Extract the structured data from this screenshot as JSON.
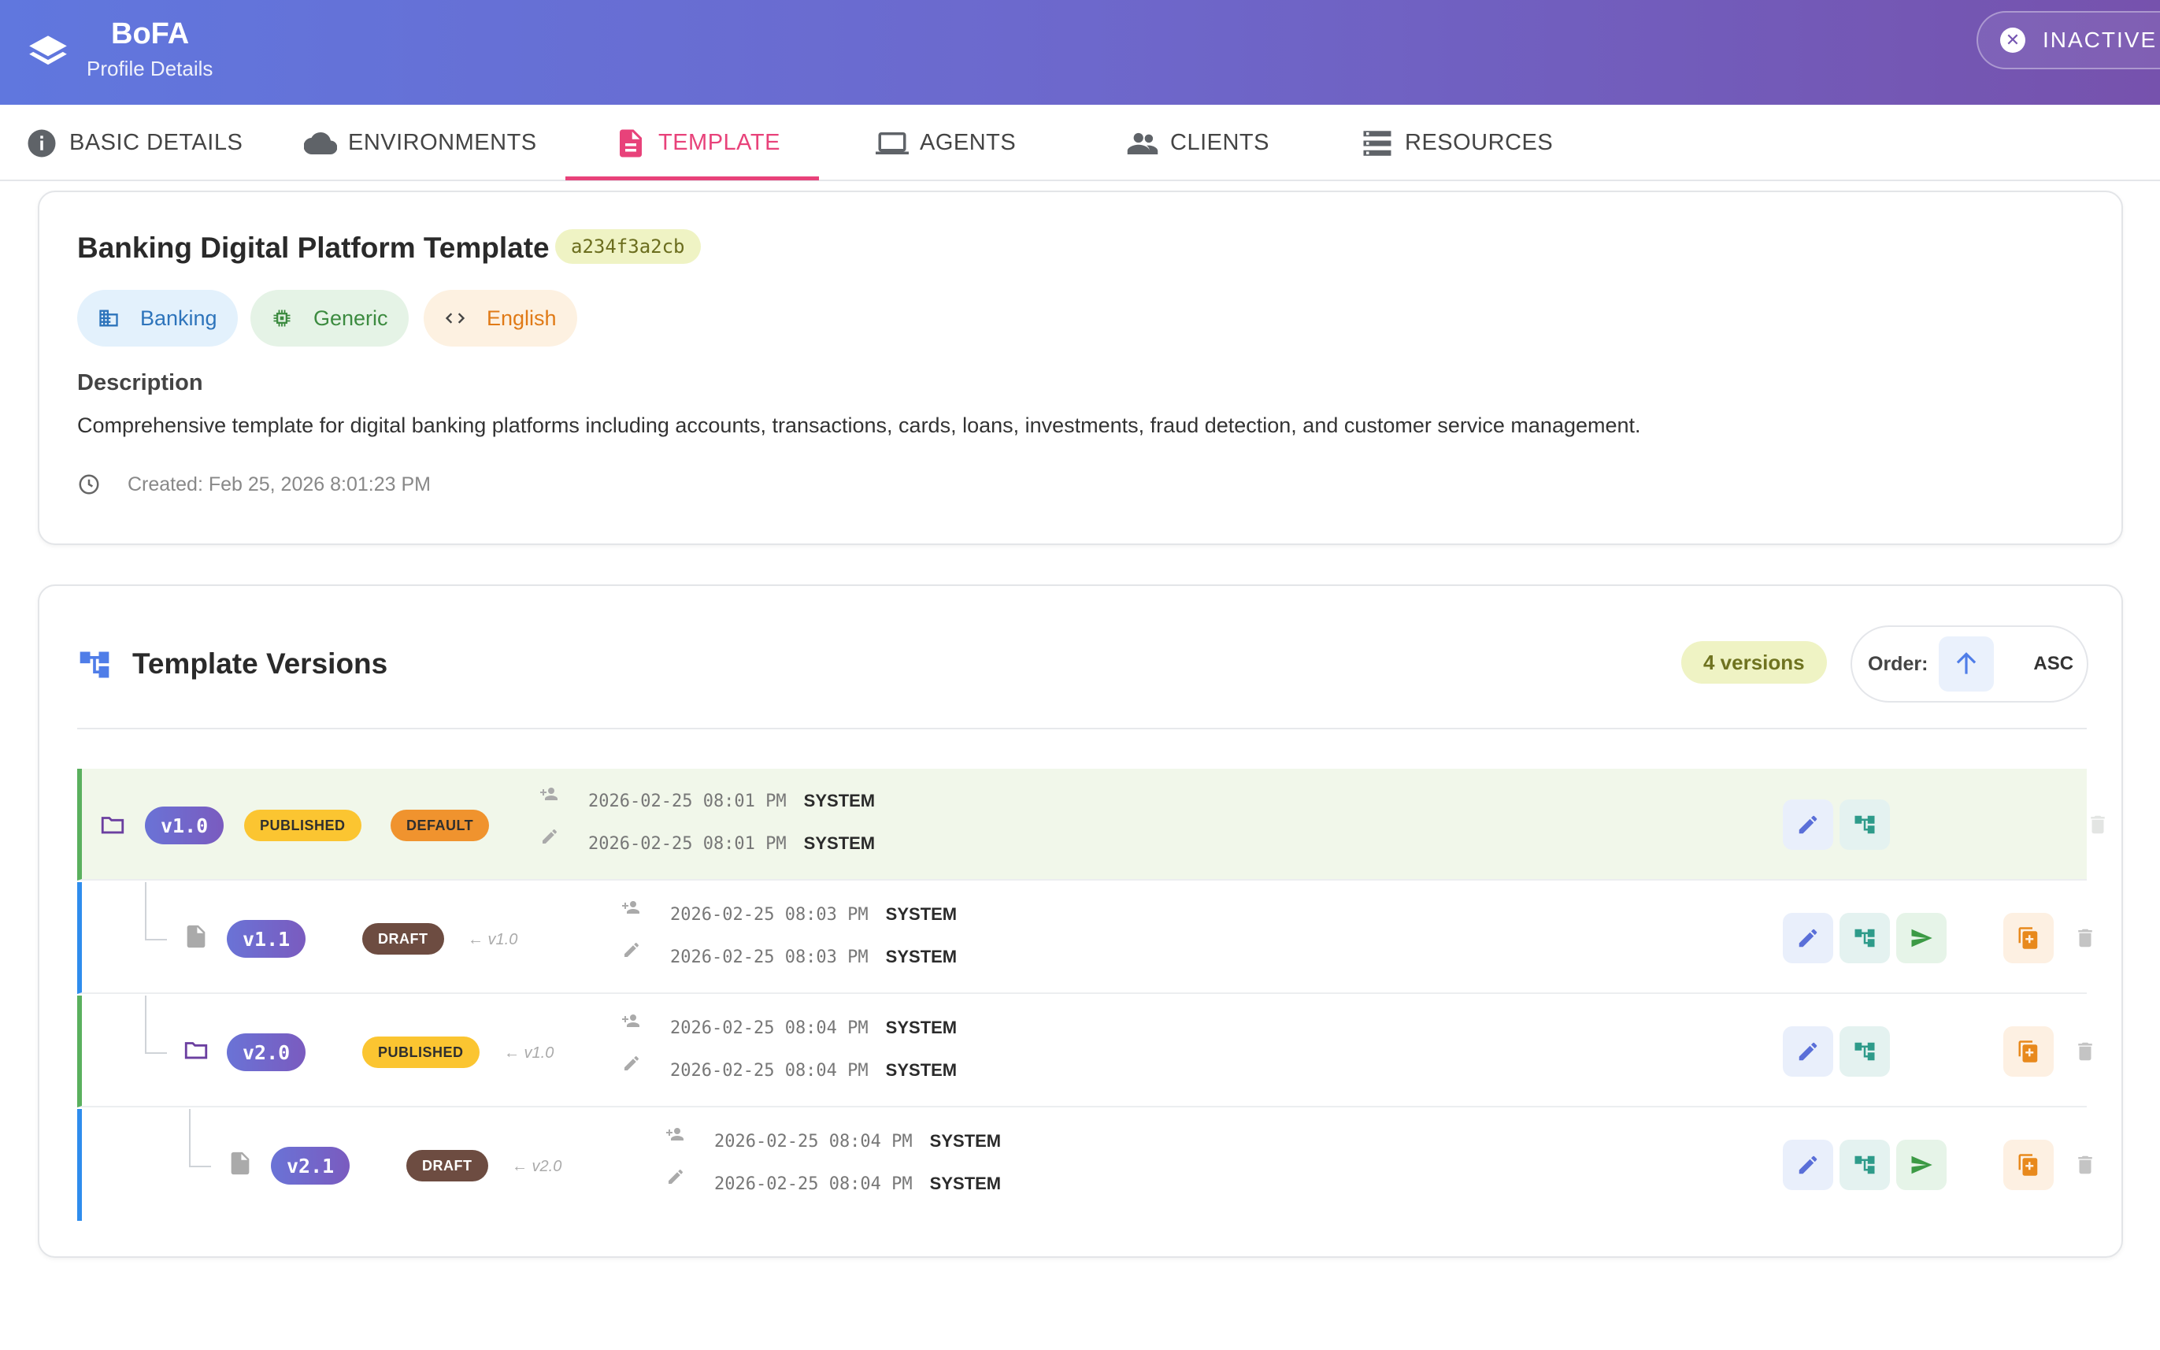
{
  "header": {
    "title": "BoFA",
    "subtitle": "Profile Details",
    "status": "INACTIVE",
    "gradient": [
      "#6077de",
      "#7652ad"
    ]
  },
  "tabs": [
    {
      "label": "BASIC DETAILS",
      "icon": "info-icon"
    },
    {
      "label": "ENVIRONMENTS",
      "icon": "cloud-icon"
    },
    {
      "label": "TEMPLATE",
      "icon": "document-icon",
      "active": true
    },
    {
      "label": "AGENTS",
      "icon": "laptop-icon"
    },
    {
      "label": "CLIENTS",
      "icon": "people-icon"
    },
    {
      "label": "RESOURCES",
      "icon": "storage-icon"
    }
  ],
  "template": {
    "name": "Banking Digital Platform Template",
    "hash": "a234f3a2cb",
    "chips": {
      "industry": "Banking",
      "type": "Generic",
      "language": "English"
    },
    "description_heading": "Description",
    "description": "Comprehensive template for digital banking platforms including accounts, transactions, cards, loans, investments, fraud detection, and customer service management.",
    "created": "Created: Feb 25, 2026 8:01:23 PM"
  },
  "versions_panel": {
    "title": "Template Versions",
    "count_label": "4 versions",
    "order_label": "Order:",
    "order_value": "ASC",
    "versions": [
      {
        "version": "v1.0",
        "badges": [
          "PUBLISHED",
          "DEFAULT"
        ],
        "parent": "",
        "created_at": "2026-02-25 08:01 PM",
        "created_by": "SYSTEM",
        "updated_at": "2026-02-25 08:01 PM",
        "updated_by": "SYSTEM"
      },
      {
        "version": "v1.1",
        "badges": [
          "DRAFT"
        ],
        "parent": "← v1.0",
        "created_at": "2026-02-25 08:03 PM",
        "created_by": "SYSTEM",
        "updated_at": "2026-02-25 08:03 PM",
        "updated_by": "SYSTEM"
      },
      {
        "version": "v2.0",
        "badges": [
          "PUBLISHED"
        ],
        "parent": "← v1.0",
        "created_at": "2026-02-25 08:04 PM",
        "created_by": "SYSTEM",
        "updated_at": "2026-02-25 08:04 PM",
        "updated_by": "SYSTEM"
      },
      {
        "version": "v2.1",
        "badges": [
          "DRAFT"
        ],
        "parent": "← v2.0",
        "created_at": "2026-02-25 08:04 PM",
        "created_by": "SYSTEM",
        "updated_at": "2026-02-25 08:04 PM",
        "updated_by": "SYSTEM"
      }
    ]
  },
  "colors": {
    "accent": "#e8427a",
    "published": "#fbc531",
    "default": "#f0932e",
    "draft": "#6d4c41",
    "branch_green": "#5ab05e",
    "branch_blue": "#2f8ded"
  }
}
